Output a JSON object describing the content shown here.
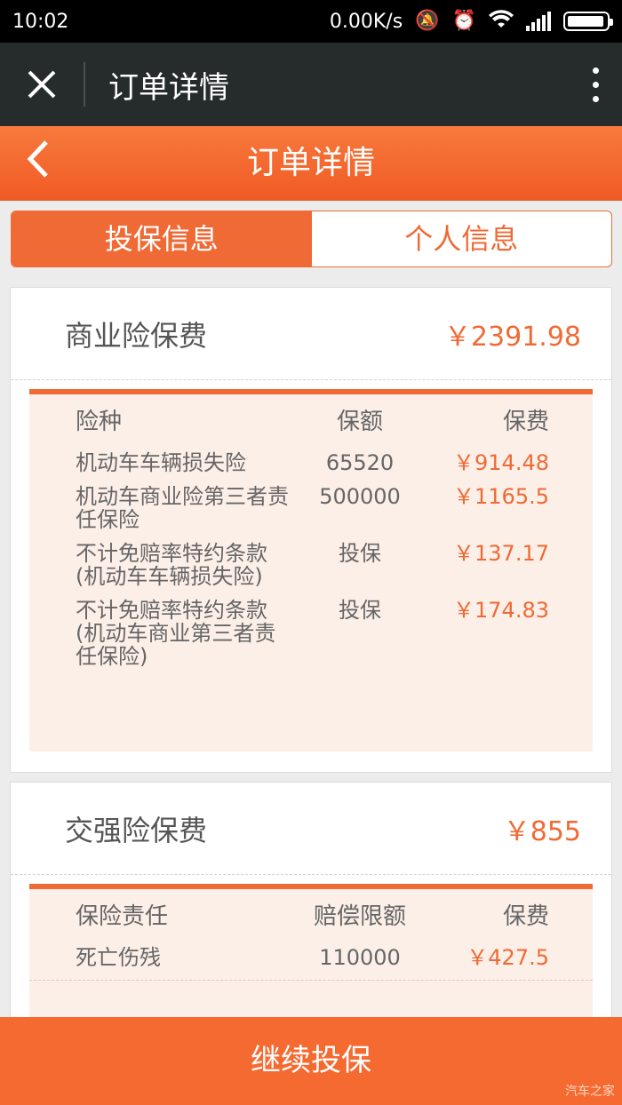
{
  "status_bar": {
    "time": "10:02",
    "speed": "0.00K/s",
    "icons": [
      "mute-icon",
      "alarm-icon",
      "wifi-icon",
      "signal-icon",
      "battery-icon"
    ]
  },
  "webview": {
    "title": "订单详情"
  },
  "header": {
    "title": "订单详情"
  },
  "tabs": [
    {
      "label": "投保信息",
      "active": true
    },
    {
      "label": "个人信息",
      "active": false
    }
  ],
  "commercial": {
    "label": "商业险保费",
    "price": "￥2391.98",
    "columns": [
      "险种",
      "保额",
      "保费"
    ],
    "rows": [
      {
        "name": "机动车车辆损失险",
        "amount": "65520",
        "fee": "￥914.48"
      },
      {
        "name": "机动车商业险第三者责任保险",
        "amount": "500000",
        "fee": "￥1165.5"
      },
      {
        "name": "不计免赔率特约条款(机动车车辆损失险)",
        "amount": "投保",
        "fee": "￥137.17"
      },
      {
        "name": "不计免赔率特约条款(机动车商业第三者责任保险)",
        "amount": "投保",
        "fee": "￥174.83"
      }
    ]
  },
  "compulsory": {
    "label": "交强险保费",
    "price": "￥855",
    "columns": [
      "保险责任",
      "赔偿限额",
      "保费"
    ],
    "rows": [
      {
        "name": "死亡伤残",
        "amount": "110000",
        "fee": "￥427.5"
      }
    ]
  },
  "footer": {
    "button_label": "继续投保"
  },
  "watermark": "汽车之家",
  "colors": {
    "accent": "#ef6a35",
    "header_dark": "#262b2b",
    "detail_bg": "#fcefe8"
  }
}
